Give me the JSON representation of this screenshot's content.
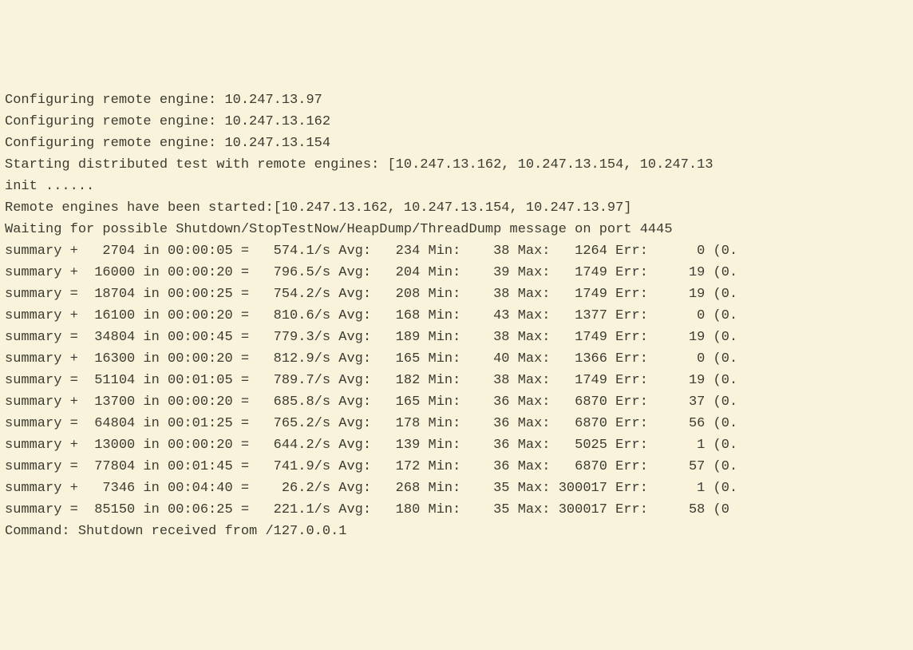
{
  "config_prefix": "Configuring remote engine: ",
  "config_ips": [
    "10.247.13.97",
    "10.247.13.162",
    "10.247.13.154"
  ],
  "start_line": "Starting distributed test with remote engines: [10.247.13.162, 10.247.13.154, 10.247.13",
  "init_line": "init ......",
  "started_line": "Remote engines have been started:[10.247.13.162, 10.247.13.154, 10.247.13.97]",
  "waiting_line": "Waiting for possible Shutdown/StopTestNow/HeapDump/ThreadDump message on port 4445",
  "summary_rows": [
    {
      "op": "+",
      "count": "2704",
      "time": "00:00:05",
      "rate": "574.1",
      "avg": "234",
      "min": "38",
      "max": "1264",
      "err": "0",
      "tail": "(0."
    },
    {
      "op": "+",
      "count": "16000",
      "time": "00:00:20",
      "rate": "796.5",
      "avg": "204",
      "min": "39",
      "max": "1749",
      "err": "19",
      "tail": "(0."
    },
    {
      "op": "=",
      "count": "18704",
      "time": "00:00:25",
      "rate": "754.2",
      "avg": "208",
      "min": "38",
      "max": "1749",
      "err": "19",
      "tail": "(0."
    },
    {
      "op": "+",
      "count": "16100",
      "time": "00:00:20",
      "rate": "810.6",
      "avg": "168",
      "min": "43",
      "max": "1377",
      "err": "0",
      "tail": "(0."
    },
    {
      "op": "=",
      "count": "34804",
      "time": "00:00:45",
      "rate": "779.3",
      "avg": "189",
      "min": "38",
      "max": "1749",
      "err": "19",
      "tail": "(0."
    },
    {
      "op": "+",
      "count": "16300",
      "time": "00:00:20",
      "rate": "812.9",
      "avg": "165",
      "min": "40",
      "max": "1366",
      "err": "0",
      "tail": "(0."
    },
    {
      "op": "=",
      "count": "51104",
      "time": "00:01:05",
      "rate": "789.7",
      "avg": "182",
      "min": "38",
      "max": "1749",
      "err": "19",
      "tail": "(0."
    },
    {
      "op": "+",
      "count": "13700",
      "time": "00:00:20",
      "rate": "685.8",
      "avg": "165",
      "min": "36",
      "max": "6870",
      "err": "37",
      "tail": "(0."
    },
    {
      "op": "=",
      "count": "64804",
      "time": "00:01:25",
      "rate": "765.2",
      "avg": "178",
      "min": "36",
      "max": "6870",
      "err": "56",
      "tail": "(0."
    },
    {
      "op": "+",
      "count": "13000",
      "time": "00:00:20",
      "rate": "644.2",
      "avg": "139",
      "min": "36",
      "max": "5025",
      "err": "1",
      "tail": "(0."
    },
    {
      "op": "=",
      "count": "77804",
      "time": "00:01:45",
      "rate": "741.9",
      "avg": "172",
      "min": "36",
      "max": "6870",
      "err": "57",
      "tail": "(0."
    },
    {
      "op": "+",
      "count": "7346",
      "time": "00:04:40",
      "rate": "26.2",
      "avg": "268",
      "min": "35",
      "max": "300017",
      "err": "1",
      "tail": "(0."
    },
    {
      "op": "=",
      "count": "85150",
      "time": "00:06:25",
      "rate": "221.1",
      "avg": "180",
      "min": "35",
      "max": "300017",
      "err": "58",
      "tail": "(0"
    }
  ],
  "shutdown_line": "Command: Shutdown received from /127.0.0.1"
}
